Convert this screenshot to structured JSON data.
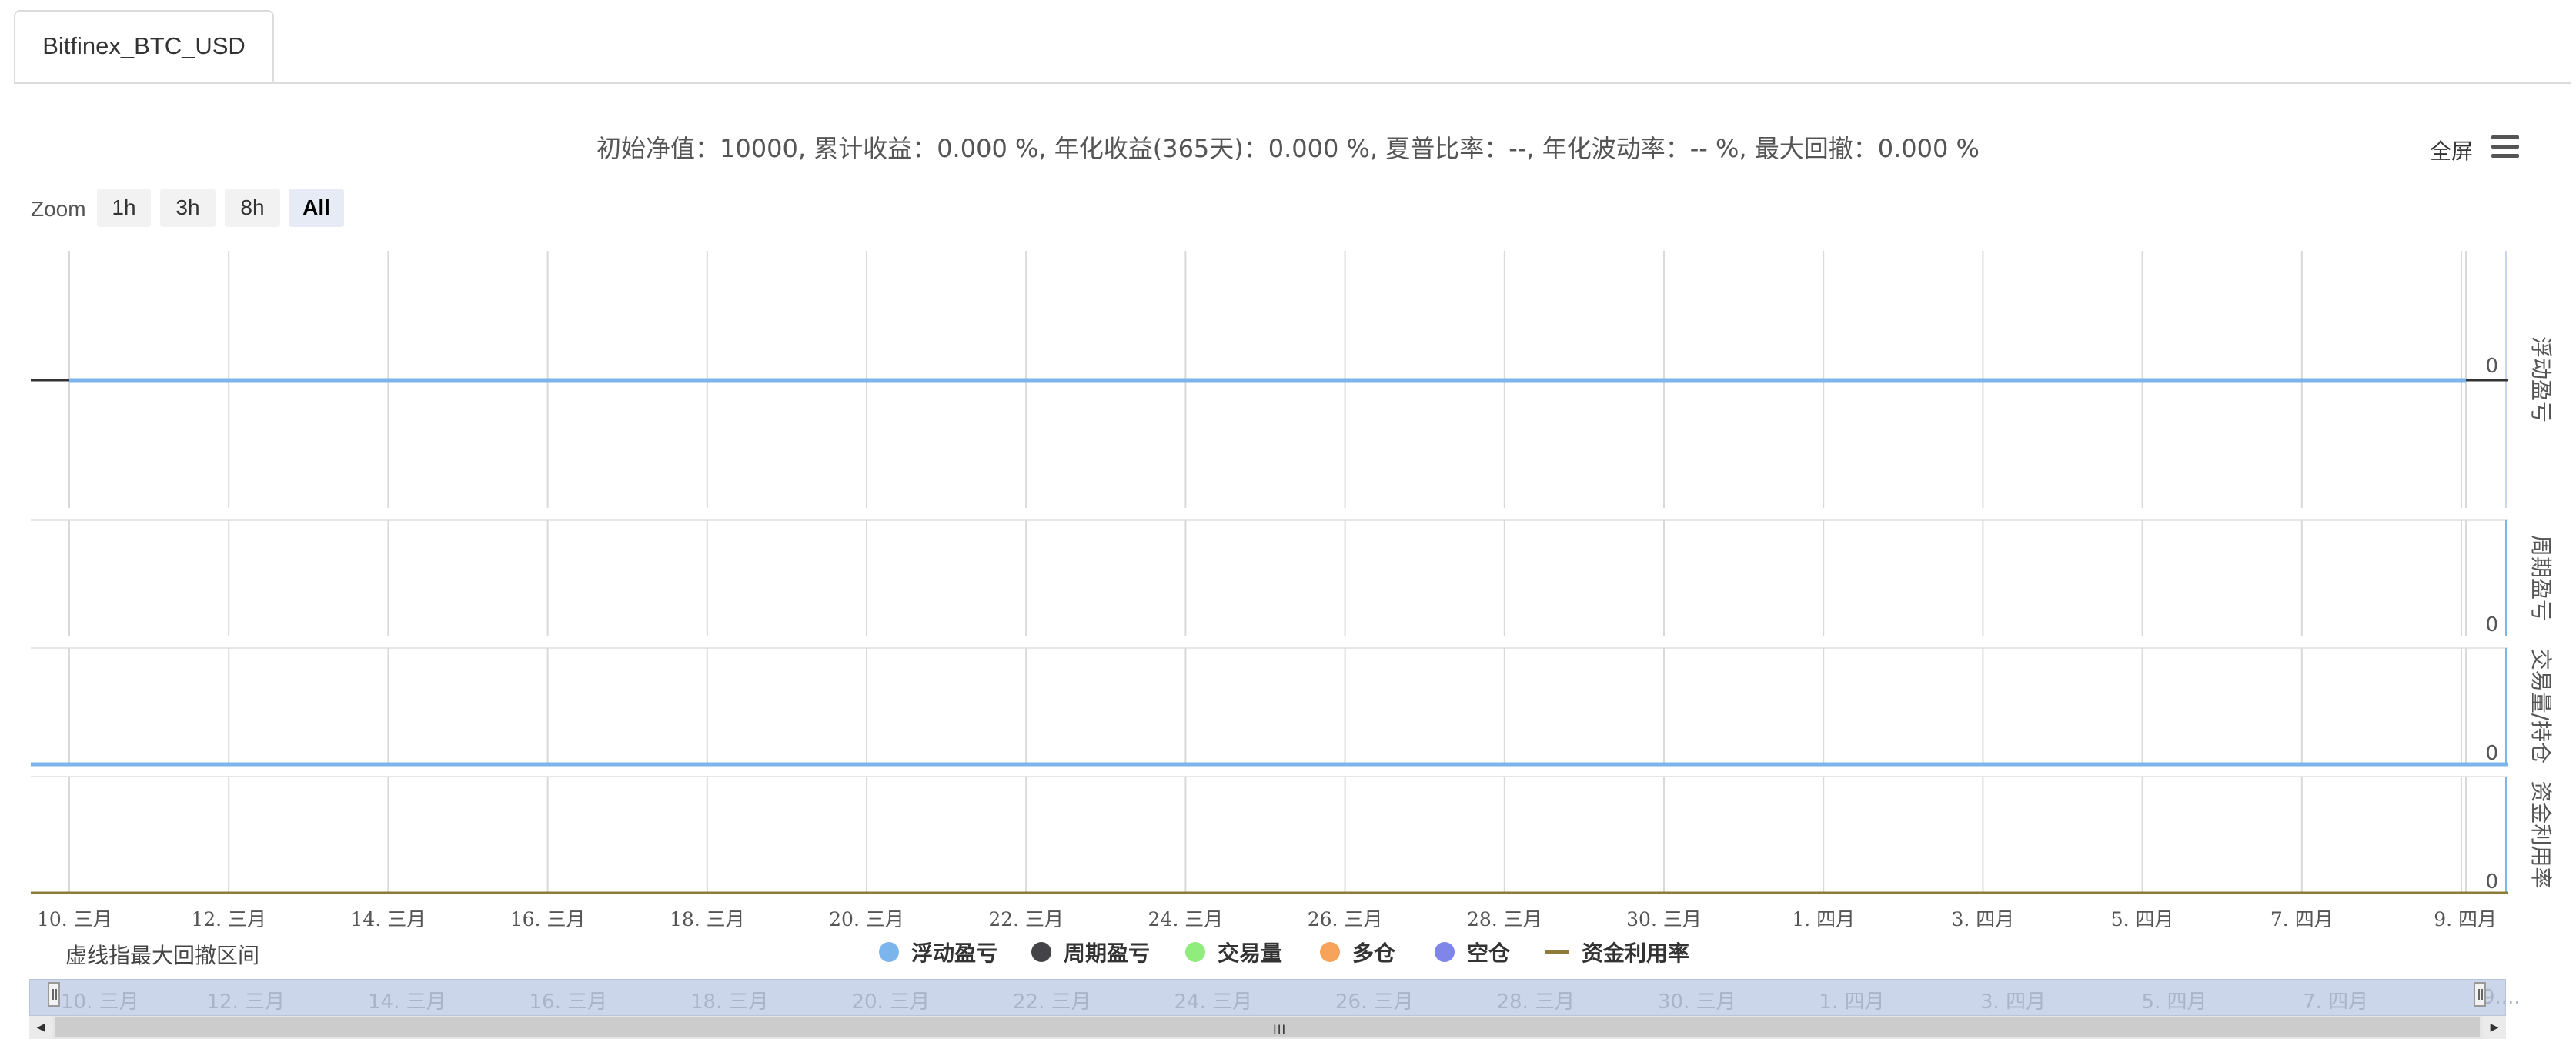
{
  "tab": {
    "label": "Bitfinex_BTC_USD"
  },
  "summary": "初始净值：10000, 累计收益：0.000 %, 年化收益(365天)：0.000 %, 夏普比率：--, 年化波动率：-- %, 最大回撤：0.000 %",
  "toolbar": {
    "fullscreen_label": "全屏",
    "menu_icon": "hamburger-menu-icon"
  },
  "zoom": {
    "label": "Zoom",
    "buttons": [
      "1h",
      "3h",
      "8h",
      "All"
    ],
    "selected": "All"
  },
  "drawdown_note": "虚线指最大回撤区间",
  "chart_data": {
    "type": "line",
    "x_axis": {
      "tick_labels": [
        "10. 三月",
        "12. 三月",
        "14. 三月",
        "16. 三月",
        "18. 三月",
        "20. 三月",
        "22. 三月",
        "24. 三月",
        "26. 三月",
        "28. 三月",
        "30. 三月",
        "1. 四月",
        "3. 四月",
        "5. 四月",
        "7. 四月",
        "9. 四月"
      ],
      "range": [
        "2019-03-10",
        "2019-04-09"
      ],
      "grid": true
    },
    "panes": [
      {
        "ylabel": "浮动盈亏",
        "tick": "0",
        "series": [
          {
            "name": "浮动盈亏",
            "color": "#7cb5ec",
            "values": [
              0,
              0,
              0,
              0,
              0,
              0,
              0,
              0,
              0,
              0,
              0,
              0,
              0,
              0,
              0,
              0
            ]
          }
        ]
      },
      {
        "ylabel": "周期盈亏",
        "tick": "0",
        "series": [
          {
            "name": "周期盈亏",
            "color": "#434348",
            "values": []
          }
        ]
      },
      {
        "ylabel": "交易量/持仓",
        "tick": "0",
        "series": [
          {
            "name": "交易量",
            "color": "#90ed7d",
            "values": [
              0,
              0,
              0,
              0,
              0,
              0,
              0,
              0,
              0,
              0,
              0,
              0,
              0,
              0,
              0,
              0
            ]
          },
          {
            "name": "多仓",
            "color": "#f7a35c",
            "values": []
          },
          {
            "name": "空仓",
            "color": "#8085e9",
            "values": []
          }
        ]
      },
      {
        "ylabel": "资金利用率",
        "tick": "0",
        "series": [
          {
            "name": "资金利用率",
            "color": "#8d7b3a",
            "values": [
              0,
              0,
              0,
              0,
              0,
              0,
              0,
              0,
              0,
              0,
              0,
              0,
              0,
              0,
              0,
              0
            ]
          }
        ]
      }
    ],
    "legend": [
      {
        "name": "浮动盈亏",
        "color": "#7cb5ec",
        "marker": "dot"
      },
      {
        "name": "周期盈亏",
        "color": "#434348",
        "marker": "dot"
      },
      {
        "name": "交易量",
        "color": "#90ed7d",
        "marker": "dot"
      },
      {
        "name": "多仓",
        "color": "#f7a35c",
        "marker": "dot"
      },
      {
        "name": "空仓",
        "color": "#8085e9",
        "marker": "dot"
      },
      {
        "name": "资金利用率",
        "color": "#8d7b3a",
        "marker": "line"
      }
    ],
    "legend_position": "bottom-center",
    "navigator_labels": [
      "10. 三月",
      "12. 三月",
      "14. 三月",
      "16. 三月",
      "18. 三月",
      "20. 三月",
      "22. 三月",
      "24. 三月",
      "26. 三月",
      "28. 三月",
      "30. 三月",
      "1. 四月",
      "3. 四月",
      "5. 四月",
      "7. 四月",
      "9...."
    ]
  }
}
